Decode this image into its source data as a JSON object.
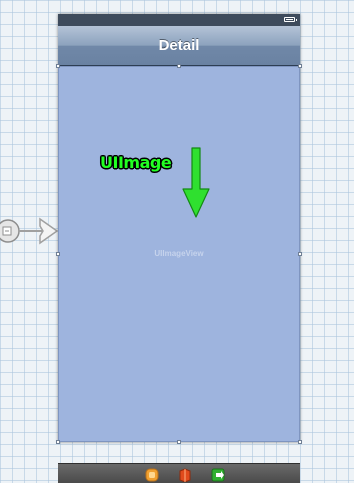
{
  "scene": {
    "nav_title": "Detail",
    "image_view_label": "UIImageView"
  },
  "annotation": {
    "text": "UIImage",
    "color": "#22ff22"
  },
  "dock": {
    "icons": [
      "first-responder-icon",
      "view-controller-icon",
      "exit-icon"
    ]
  },
  "colors": {
    "image_view_bg": "#9eb4de",
    "nav_bar": "#8ca2bd",
    "canvas_bg": "#eef3f7"
  }
}
